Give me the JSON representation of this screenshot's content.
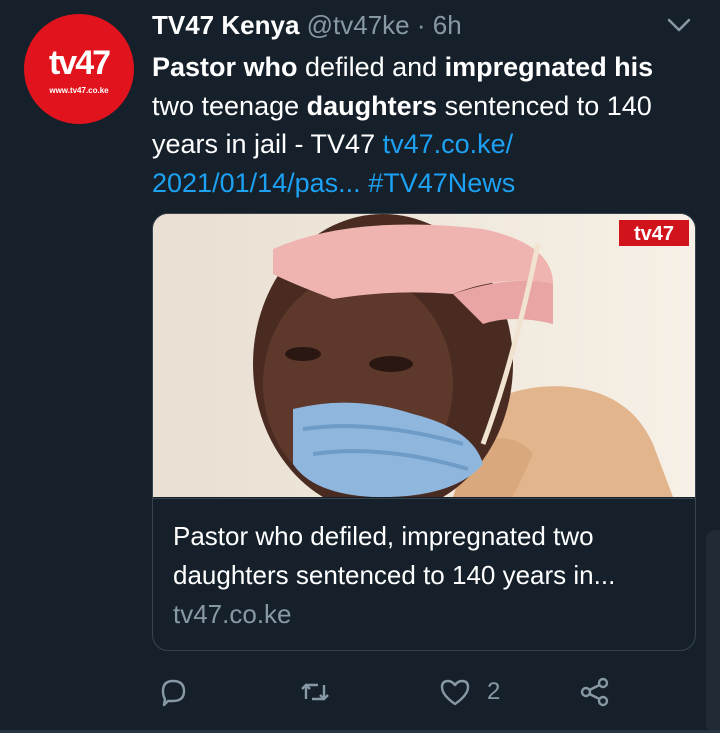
{
  "account": {
    "display_name": "TV47 Kenya",
    "handle": "@tv47ke",
    "separator": "·",
    "time": "6h",
    "avatar": {
      "logo_text": "tv47",
      "url_text": "www.tv47.co.ke"
    }
  },
  "tweet": {
    "segments": [
      {
        "text": "Pastor who",
        "style": "bold"
      },
      {
        "text": " defiled and ",
        "style": "normal"
      },
      {
        "text": "impregnated his",
        "style": "bold"
      },
      {
        "text": " two teenage ",
        "style": "normal"
      },
      {
        "text": "daughters",
        "style": "bold"
      },
      {
        "text": " sentenced to 140 years in jail - TV47 ",
        "style": "normal"
      },
      {
        "text": "tv47.co.ke/ 2021/01/14/pas...",
        "style": "link"
      },
      {
        "text": " ",
        "style": "normal"
      },
      {
        "text": "#TV47News",
        "style": "link"
      }
    ]
  },
  "card": {
    "image_badge": "tv47",
    "title": "Pastor who defiled, impregnated two daughters sentenced to 140 years in...",
    "domain": "tv47.co.ke"
  },
  "actions": {
    "like_count": "2",
    "icons": [
      "reply-icon",
      "retweet-icon",
      "like-icon",
      "share-icon"
    ]
  },
  "colors": {
    "background": "#15202b",
    "link": "#1da1f2",
    "secondary_text": "#8899a6",
    "brand_red": "#e1141d"
  }
}
